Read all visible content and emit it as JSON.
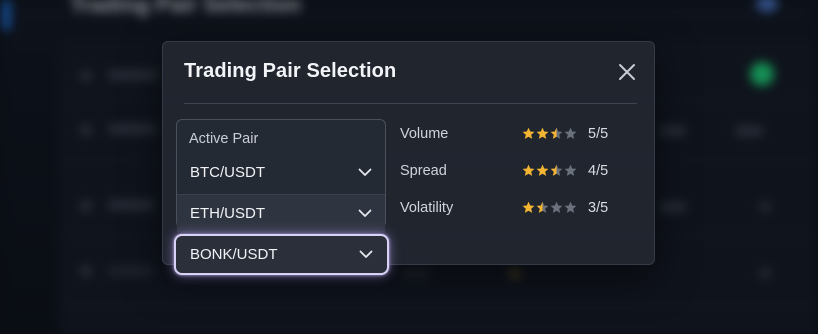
{
  "background": {
    "title": "Trading Pair Selection"
  },
  "modal": {
    "title": "Trading Pair Selection",
    "close_icon": "close-icon",
    "active_pair": {
      "label": "Active Pair",
      "options": [
        {
          "label": "BTC/USDT",
          "state": "default"
        },
        {
          "label": "ETH/USDT",
          "state": "hover"
        },
        {
          "label": "BONK/USDT",
          "state": "focused"
        }
      ]
    },
    "metrics": [
      {
        "label": "Volume",
        "stars": 2.5,
        "score": "5/5"
      },
      {
        "label": "Spread",
        "stars": 2.5,
        "score": "4/5"
      },
      {
        "label": "Volatility",
        "stars": 1.5,
        "score": "3/5"
      }
    ]
  },
  "colors": {
    "star_filled": "#f4b532",
    "star_empty": "#6b717c",
    "focus_ring": "#d9d2f6",
    "status_green": "#1fd67a"
  }
}
